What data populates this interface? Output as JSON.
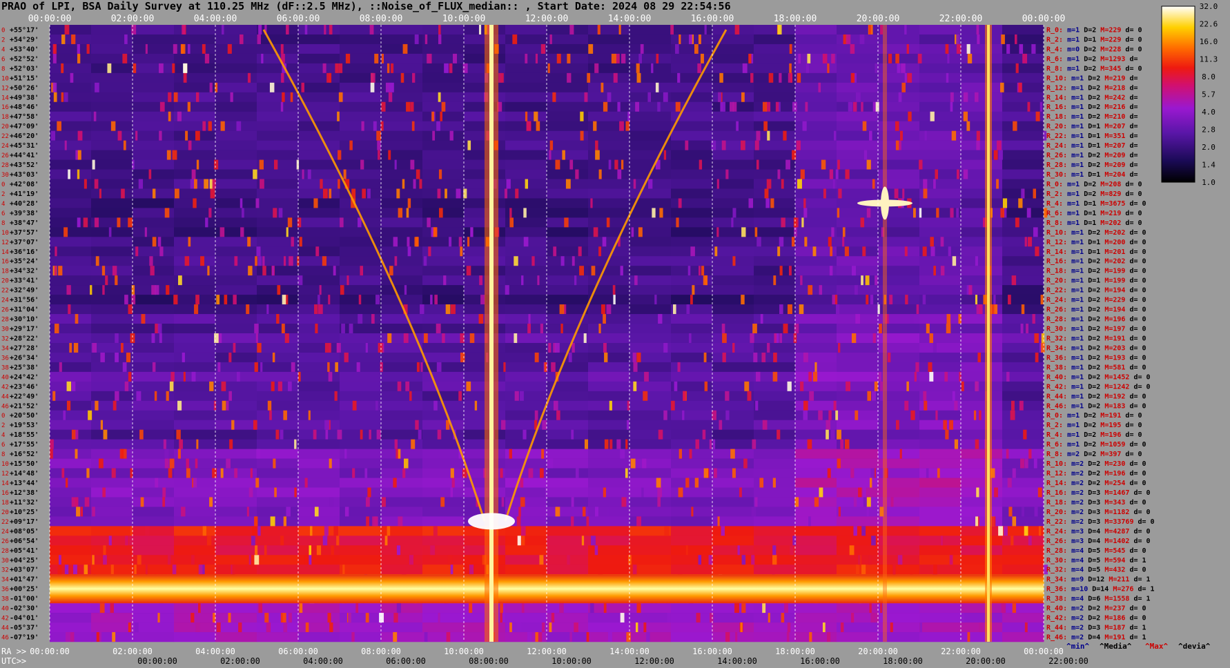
{
  "title": "PRAO of LPI, BSA Daily Survey at 110.25 MHz (dF::2.5 MHz), ::Noise_of_FLUX_median:: , Start Date: 2024 08 29 22:54:56",
  "chart_data": {
    "type": "heatmap",
    "top_axis_ticks": [
      "00:00:00",
      "02:00:00",
      "04:00:00",
      "06:00:00",
      "08:00:00",
      "10:00:00",
      "12:00:00",
      "14:00:00",
      "16:00:00",
      "18:00:00",
      "20:00:00",
      "22:00:00",
      "00:00:00"
    ],
    "ra_axis_label": "RA >>",
    "ra_axis_ticks": [
      "00:00:00",
      "02:00:00",
      "04:00:00",
      "06:00:00",
      "08:00:00",
      "10:00:00",
      "12:00:00",
      "14:00:00",
      "16:00:00",
      "18:00:00",
      "20:00:00",
      "22:00:00",
      "00:00:00"
    ],
    "utc_axis_label": "UTC>>",
    "utc_axis_ticks": [
      "00:00:00",
      "02:00:00",
      "04:00:00",
      "06:00:00",
      "08:00:00",
      "10:00:00",
      "12:00:00",
      "14:00:00",
      "16:00:00",
      "18:00:00",
      "20:00:00",
      "22:00:00"
    ],
    "declinations": [
      "+55°17'",
      "+54°29'",
      "+53°40'",
      "+52°52'",
      "+52°03'",
      "+51°15'",
      "+50°26'",
      "+49°38'",
      "+48°46'",
      "+47°58'",
      "+47°09'",
      "+46°20'",
      "+45°31'",
      "+44°41'",
      "+43°52'",
      "+43°03'",
      "+42°08'",
      "+41°19'",
      "+40°28'",
      "+39°38'",
      "+38°47'",
      "+37°57'",
      "+37°07'",
      "+36°16'",
      "+35°24'",
      "+34°32'",
      "+33°41'",
      "+32°49'",
      "+31°56'",
      "+31°04'",
      "+30°10'",
      "+29°17'",
      "+28°22'",
      "+27°28'",
      "+26°34'",
      "+25°38'",
      "+24°42'",
      "+23°46'",
      "+22°49'",
      "+21°52'",
      "+20°50'",
      "+19°53'",
      "+18°55'",
      "+17°55'",
      "+16°52'",
      "+15°50'",
      "+14°48'",
      "+13°44'",
      "+12°38'",
      "+11°32'",
      "+10°25'",
      "+09°17'",
      "+08°05'",
      "+06°54'",
      "+05°41'",
      "+04°25'",
      "+03°07'",
      "+01°47'",
      "+00°25'",
      "-01°00'",
      "-02°30'",
      "-04°01'",
      "-05°37'",
      "-07°19'"
    ],
    "row_indices": [
      "0",
      "2",
      "4",
      "6",
      "8",
      "10",
      "12",
      "14",
      "16",
      "18",
      "20",
      "22",
      "24",
      "26",
      "28",
      "30",
      "0",
      "2",
      "4",
      "6",
      "8",
      "10",
      "12",
      "14",
      "16",
      "18",
      "20",
      "22",
      "24",
      "26",
      "28",
      "30",
      "32",
      "34",
      "36",
      "38",
      "40",
      "42",
      "44",
      "46",
      "0",
      "2",
      "4",
      "6",
      "8",
      "10",
      "12",
      "14",
      "16",
      "18",
      "20",
      "22",
      "24",
      "26",
      "28",
      "30",
      "32",
      "34",
      "36",
      "38",
      "40",
      "42",
      "44",
      "46"
    ],
    "stats": [
      [
        "R_0:",
        "m=1",
        "D=2",
        "M=229",
        "d= 0"
      ],
      [
        "R_2:",
        "m=1",
        "D=1",
        "M=229",
        "d= 0"
      ],
      [
        "R_4:",
        "m=0",
        "D=2",
        "M=228",
        "d= 0"
      ],
      [
        "R_6:",
        "m=1",
        "D=2",
        "M=1293",
        "d="
      ],
      [
        "R_8:",
        "m=1",
        "D=2",
        "M=345",
        "d= 0"
      ],
      [
        "R_10:",
        "m=1",
        "D=2",
        "M=219",
        "d="
      ],
      [
        "R_12:",
        "m=1",
        "D=2",
        "M=218",
        "d="
      ],
      [
        "R_14:",
        "m=1",
        "D=2",
        "M=242",
        "d="
      ],
      [
        "R_16:",
        "m=1",
        "D=2",
        "M=216",
        "d="
      ],
      [
        "R_18:",
        "m=1",
        "D=2",
        "M=210",
        "d="
      ],
      [
        "R_20:",
        "m=1",
        "D=1",
        "M=207",
        "d="
      ],
      [
        "R_22:",
        "m=1",
        "D=1",
        "M=351",
        "d="
      ],
      [
        "R_24:",
        "m=1",
        "D=1",
        "M=207",
        "d="
      ],
      [
        "R_26:",
        "m=1",
        "D=2",
        "M=209",
        "d="
      ],
      [
        "R_28:",
        "m=1",
        "D=2",
        "M=209",
        "d="
      ],
      [
        "R_30:",
        "m=1",
        "D=1",
        "M=204",
        "d="
      ],
      [
        "R_0:",
        "m=1",
        "D=2",
        "M=208",
        "d= 0"
      ],
      [
        "R_2:",
        "m=1",
        "D=2",
        "M=829",
        "d= 0"
      ],
      [
        "R_4:",
        "m=1",
        "D=1",
        "M=3675",
        "d= 0"
      ],
      [
        "R_6:",
        "m=1",
        "D=1",
        "M=219",
        "d= 0"
      ],
      [
        "R_8:",
        "m=1",
        "D=1",
        "M=202",
        "d= 0"
      ],
      [
        "R_10:",
        "m=1",
        "D=2",
        "M=202",
        "d= 0"
      ],
      [
        "R_12:",
        "m=1",
        "D=1",
        "M=200",
        "d= 0"
      ],
      [
        "R_14:",
        "m=1",
        "D=1",
        "M=201",
        "d= 0"
      ],
      [
        "R_16:",
        "m=1",
        "D=2",
        "M=202",
        "d= 0"
      ],
      [
        "R_18:",
        "m=1",
        "D=2",
        "M=199",
        "d= 0"
      ],
      [
        "R_20:",
        "m=1",
        "D=1",
        "M=199",
        "d= 0"
      ],
      [
        "R_22:",
        "m=1",
        "D=2",
        "M=194",
        "d= 0"
      ],
      [
        "R_24:",
        "m=1",
        "D=2",
        "M=229",
        "d= 0"
      ],
      [
        "R_26:",
        "m=1",
        "D=2",
        "M=194",
        "d= 0"
      ],
      [
        "R_28:",
        "m=1",
        "D=2",
        "M=196",
        "d= 0"
      ],
      [
        "R_30:",
        "m=1",
        "D=2",
        "M=197",
        "d= 0"
      ],
      [
        "R_32:",
        "m=1",
        "D=2",
        "M=191",
        "d= 0"
      ],
      [
        "R_34:",
        "m=1",
        "D=2",
        "M=203",
        "d= 0"
      ],
      [
        "R_36:",
        "m=1",
        "D=2",
        "M=193",
        "d= 0"
      ],
      [
        "R_38:",
        "m=1",
        "D=2",
        "M=581",
        "d= 0"
      ],
      [
        "R_40:",
        "m=1",
        "D=2",
        "M=1452",
        "d= 0"
      ],
      [
        "R_42:",
        "m=1",
        "D=2",
        "M=1242",
        "d= 0"
      ],
      [
        "R_44:",
        "m=1",
        "D=2",
        "M=192",
        "d= 0"
      ],
      [
        "R_46:",
        "m=1",
        "D=2",
        "M=183",
        "d= 0"
      ],
      [
        "R_0:",
        "m=1",
        "D=2",
        "M=191",
        "d= 0"
      ],
      [
        "R_2:",
        "m=1",
        "D=2",
        "M=195",
        "d= 0"
      ],
      [
        "R_4:",
        "m=1",
        "D=2",
        "M=196",
        "d= 0"
      ],
      [
        "R_6:",
        "m=1",
        "D=2",
        "M=1059",
        "d= 0"
      ],
      [
        "R_8:",
        "m=2",
        "D=2",
        "M=397",
        "d= 0"
      ],
      [
        "R_10:",
        "m=2",
        "D=2",
        "M=230",
        "d= 0"
      ],
      [
        "R_12:",
        "m=2",
        "D=2",
        "M=196",
        "d= 0"
      ],
      [
        "R_14:",
        "m=2",
        "D=2",
        "M=254",
        "d= 0"
      ],
      [
        "R_16:",
        "m=2",
        "D=3",
        "M=1467",
        "d= 0"
      ],
      [
        "R_18:",
        "m=2",
        "D=3",
        "M=343",
        "d= 0"
      ],
      [
        "R_20:",
        "m=2",
        "D=3",
        "M=1182",
        "d= 0"
      ],
      [
        "R_22:",
        "m=2",
        "D=3",
        "M=33769",
        "d= 0"
      ],
      [
        "R_24:",
        "m=3",
        "D=4",
        "M=4287",
        "d= 0"
      ],
      [
        "R_26:",
        "m=3",
        "D=4",
        "M=1402",
        "d= 0"
      ],
      [
        "R_28:",
        "m=4",
        "D=5",
        "M=545",
        "d= 0"
      ],
      [
        "R_30:",
        "m=4",
        "D=5",
        "M=594",
        "d= 1"
      ],
      [
        "R_32:",
        "m=4",
        "D=5",
        "M=432",
        "d= 0"
      ],
      [
        "R_34:",
        "m=9",
        "D=12",
        "M=211",
        "d= 1"
      ],
      [
        "R_36:",
        "m=10",
        "D=14",
        "M=276",
        "d= 1"
      ],
      [
        "R_38:",
        "m=4",
        "D=6",
        "M=1558",
        "d= 1"
      ],
      [
        "R_40:",
        "m=2",
        "D=2",
        "M=237",
        "d= 0"
      ],
      [
        "R_42:",
        "m=2",
        "D=2",
        "M=186",
        "d= 0"
      ],
      [
        "R_44:",
        "m=2",
        "D=3",
        "M=187",
        "d= 1"
      ],
      [
        "R_46:",
        "m=2",
        "D=4",
        "M=191",
        "d= 1"
      ]
    ],
    "colorbar_ticks": [
      "32.0",
      "22.6",
      "16.0",
      "11.3",
      "8.0",
      "5.7",
      "4.0",
      "2.8",
      "2.0",
      "1.4",
      "1.0"
    ],
    "legend": [
      "^min^",
      "^Media^",
      "^Max^",
      "^devia^"
    ],
    "colors": {
      "background": "#9b9b9b",
      "stat_label": "#cc0000",
      "stat_m": "#00008b",
      "stat_M": "#cc0000",
      "legend_min": "#00008b",
      "legend_media": "#000000",
      "legend_max": "#cc0000",
      "legend_devia": "#000000"
    },
    "features": {
      "horizontal_bands_dec": [
        "+01°47'",
        "+00°25'",
        "-01°00'"
      ],
      "bright_vertical_source_ra": "10:40",
      "second_vertical_source_ra": "22:40",
      "bright_point_source": {
        "ra": "20:10",
        "dec": "+40°28'"
      },
      "diagonal_tracks": [
        {
          "from_ra": "05:10",
          "from_dec": "+55°17'",
          "to_ra": "10:30",
          "to_dec": "+09°17'"
        },
        {
          "from_ra": "16:20",
          "from_dec": "+55°17'",
          "to_ra": "11:00",
          "to_dec": "+09°17'"
        }
      ]
    }
  }
}
